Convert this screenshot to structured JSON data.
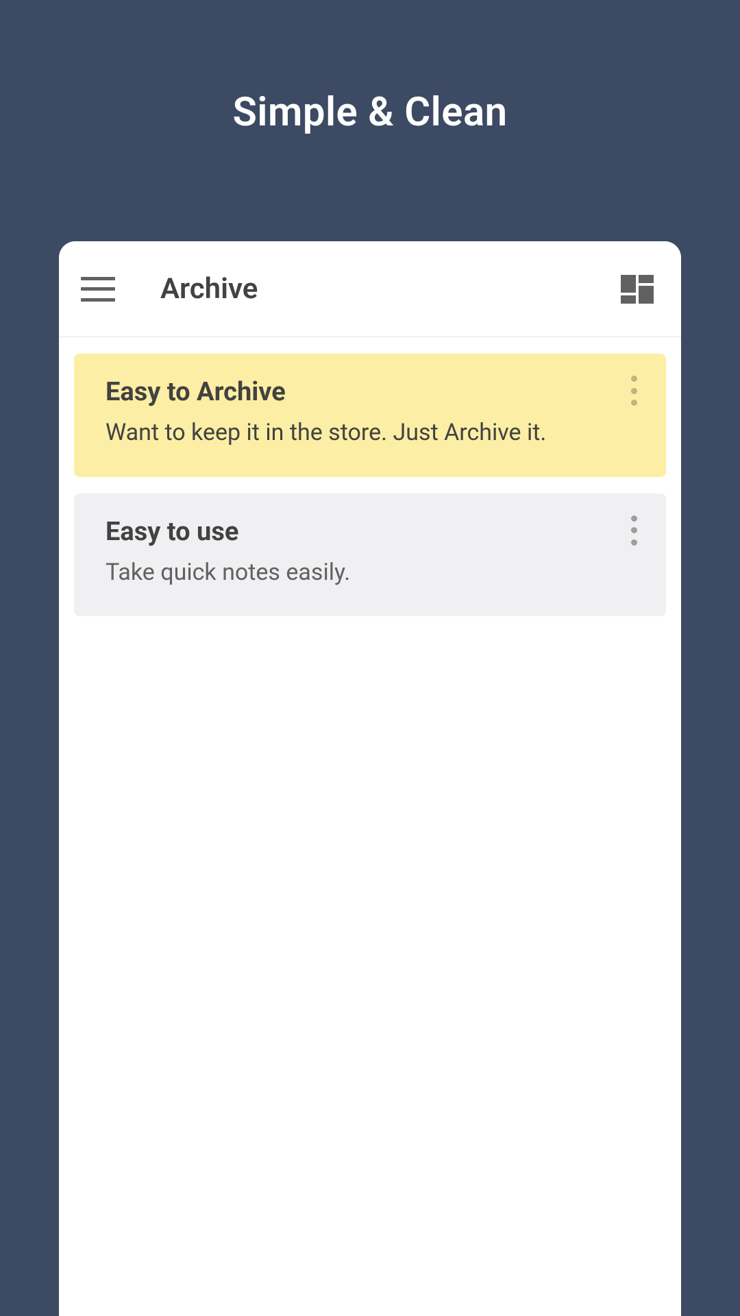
{
  "marketing": {
    "title": "Simple & Clean"
  },
  "header": {
    "title": "Archive"
  },
  "notes": [
    {
      "title": "Easy to Archive",
      "body": "Want to keep it in the store. Just Archive it.",
      "color": "yellow"
    },
    {
      "title": "Easy to use",
      "body": "Take quick notes easily.",
      "color": "gray"
    }
  ]
}
